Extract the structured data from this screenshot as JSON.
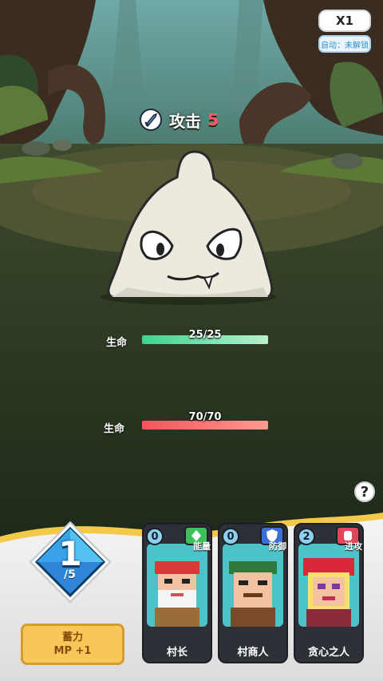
{
  "top_controls": {
    "speed": "X1",
    "auto_status": "自动：未解锁"
  },
  "enemy": {
    "attack_label": "攻击",
    "attack_value": "5",
    "hp_label": "生命",
    "hp_text": "25/25",
    "hp_fraction": 1.0
  },
  "player": {
    "hp_label": "生命",
    "hp_text": "70/70",
    "hp_fraction": 1.0
  },
  "help": {
    "label": "?"
  },
  "mp": {
    "current": "1",
    "max": "/5"
  },
  "charge_button": {
    "line1": "蓄力",
    "line2": "MP +1"
  },
  "cards": [
    {
      "cost": "0",
      "type": "能量",
      "type_icon": "diamond-icon",
      "type_color": "#3dbf5c",
      "name": "村长"
    },
    {
      "cost": "0",
      "type": "防御",
      "type_icon": "shield-icon",
      "type_color": "#3b6fd6",
      "name": "村商人"
    },
    {
      "cost": "2",
      "type": "进攻",
      "type_icon": "fist-icon",
      "type_color": "#e0475a",
      "name": "贪心之人"
    }
  ],
  "colors": {
    "enemy_hp": "#5fe0a0",
    "player_hp": "#ff6b6b",
    "accent_gold": "#f7c75a"
  }
}
